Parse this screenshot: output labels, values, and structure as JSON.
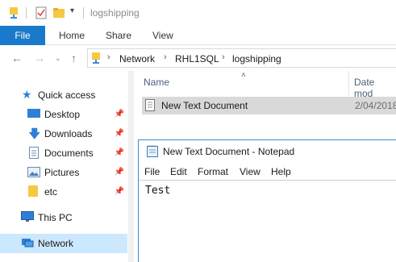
{
  "window": {
    "title": "logshipping"
  },
  "ribbon": {
    "tabs": [
      "File",
      "Home",
      "Share",
      "View"
    ]
  },
  "address": {
    "crumbs": [
      "Network",
      "RHL1SQL",
      "logshipping"
    ]
  },
  "sidebar": {
    "items": [
      {
        "label": "Quick access",
        "icon": "star-icon"
      },
      {
        "label": "Desktop",
        "icon": "desktop-icon",
        "pinned": true
      },
      {
        "label": "Downloads",
        "icon": "download-icon",
        "pinned": true
      },
      {
        "label": "Documents",
        "icon": "documents-icon",
        "pinned": true
      },
      {
        "label": "Pictures",
        "icon": "pictures-icon",
        "pinned": true
      },
      {
        "label": "etc",
        "icon": "folder-icon",
        "pinned": true
      },
      {
        "label": "This PC",
        "icon": "computer-icon"
      },
      {
        "label": "Network",
        "icon": "network-icon",
        "selected": true
      }
    ]
  },
  "main": {
    "columns": {
      "name": "Name",
      "date": "Date mod"
    },
    "files": [
      {
        "name": "New Text Document",
        "date": "2/04/2018"
      }
    ]
  },
  "notepad": {
    "title": "New Text Document - Notepad",
    "menu": [
      "File",
      "Edit",
      "Format",
      "View",
      "Help"
    ],
    "content": "Test"
  },
  "colors": {
    "file_tab": "#1979ca",
    "selection": "#cce8ff",
    "row_highlight": "#d9d9d9",
    "folder": "#f5c842"
  }
}
